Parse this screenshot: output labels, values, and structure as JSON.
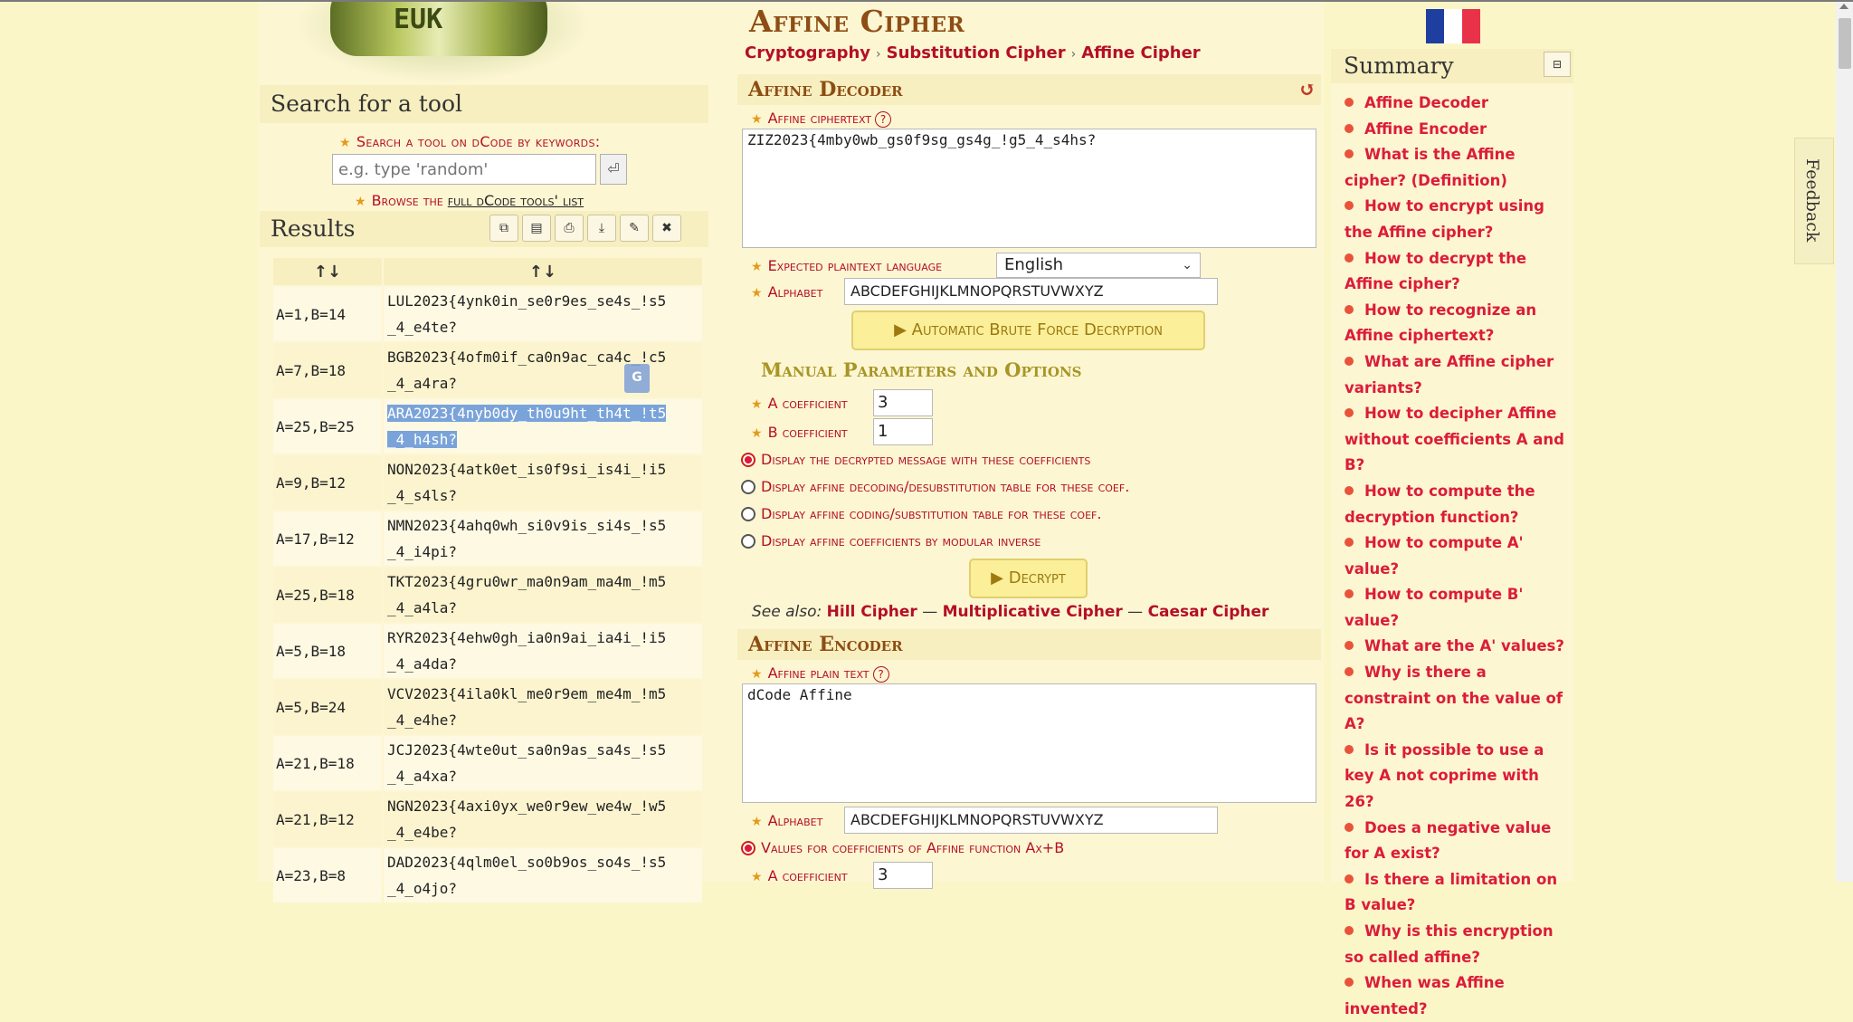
{
  "left": {
    "logo_letters": "EUK",
    "search": {
      "title": "Search for a tool",
      "keywords_label": "Search a tool on dCode by keywords:",
      "placeholder": "e.g. type 'random'",
      "go_icon": "enter-icon",
      "browse_prefix": "Browse the",
      "browse_link": "full dCode tools' list"
    },
    "results": {
      "title": "Results",
      "buttons": [
        "copy-icon",
        "copy-all-icon",
        "print-icon",
        "download-icon",
        "pin-icon",
        "close-icon"
      ],
      "headers": [
        "↑↓",
        "↑↓"
      ],
      "rows": [
        {
          "key": "A=1,B=14",
          "line1": "LUL2023{4ynk0in_se0r9es_se4s_!s5",
          "line2": "_4_e4te?"
        },
        {
          "key": "A=7,B=18",
          "line1": "BGB2023{4ofm0if_ca0n9ac_ca4c_!c5",
          "line2": "_4_a4ra?"
        },
        {
          "key": "A=25,B=25",
          "line1": "ARA2023{4nyb0dy_th0u9ht_th4t_!t5",
          "line2": "_4_h4sh?"
        },
        {
          "key": "A=9,B=12",
          "line1": "NON2023{4atk0et_is0f9si_is4i_!i5",
          "line2": "_4_s4ls?"
        },
        {
          "key": "A=17,B=12",
          "line1": "NMN2023{4ahq0wh_si0v9is_si4s_!s5",
          "line2": "_4_i4pi?"
        },
        {
          "key": "A=25,B=18",
          "line1": "TKT2023{4gru0wr_ma0n9am_ma4m_!m5",
          "line2": "_4_a4la?"
        },
        {
          "key": "A=5,B=18",
          "line1": "RYR2023{4ehw0gh_ia0n9ai_ia4i_!i5",
          "line2": "_4_a4da?"
        },
        {
          "key": "A=5,B=24",
          "line1": "VCV2023{4ila0kl_me0r9em_me4m_!m5",
          "line2": "_4_e4he?"
        },
        {
          "key": "A=21,B=18",
          "line1": "JCJ2023{4wte0ut_sa0n9as_sa4s_!s5",
          "line2": "_4_a4xa?"
        },
        {
          "key": "A=21,B=12",
          "line1": "NGN2023{4axi0yx_we0r9ew_we4w_!w5",
          "line2": "_4_e4be?"
        },
        {
          "key": "A=23,B=8",
          "line1": "DAD2023{4qlm0el_so0b9os_so4s_!s5",
          "line2": "_4_o4jo?"
        }
      ]
    }
  },
  "main": {
    "title": "Affine Cipher",
    "breadcrumb": [
      "Cryptography",
      "Substitution Cipher",
      "Affine Cipher"
    ],
    "flag_colors": [
      "#1f3fa0",
      "#ffffff",
      "#e8324a"
    ],
    "decoder": {
      "title": "Affine Decoder",
      "ciphertext_label": "Affine ciphertext",
      "ciphertext": "ZIZ2023{4mby0wb_gs0f9sg_gs4g_!g5_4_s4hs?",
      "lang_label": "Expected plaintext language",
      "lang_value": "English",
      "alphabet_label": "Alphabet",
      "alphabet": "ABCDEFGHIJKLMNOPQRSTUVWXYZ",
      "brute_button": "▶ Automatic Brute Force Decryption",
      "manual_title": "Manual Parameters and Options",
      "a_label": "A coefficient",
      "a_value": "3",
      "b_label": "B coefficient",
      "b_value": "1",
      "radio_options": [
        "Display the decrypted message with these coefficients",
        "Display affine decoding/desubstitution table for these coef.",
        "Display affine coding/substitution table for these coef.",
        "Display affine coefficients by modular inverse"
      ],
      "decrypt_button": "▶ Decrypt",
      "see_also_label": "See also:",
      "see_also": [
        "Hill Cipher",
        "Multiplicative Cipher",
        "Caesar Cipher"
      ]
    },
    "encoder": {
      "title": "Affine Encoder",
      "plain_label": "Affine plain text",
      "plain_text": "dCode Affine",
      "alphabet_label": "Alphabet",
      "alphabet": "ABCDEFGHIJKLMNOPQRSTUVWXYZ",
      "values_option": "Values for coefficients of Affine function Ax+B",
      "a_label": "A coefficient",
      "a_value": "3"
    }
  },
  "summary": {
    "title": "Summary",
    "items": [
      "Affine Decoder",
      "Affine Encoder",
      "What is the Affine cipher? (Definition)",
      "How to encrypt using the Affine cipher?",
      "How to decrypt the Affine cipher?",
      "How to recognize an Affine ciphertext?",
      "What are Affine cipher variants?",
      "How to decipher Affine without coefficients A and B?",
      "How to compute the decryption function?",
      "How to compute A' value?",
      "How to compute B' value?",
      "What are the A' values?",
      "Why is there a constraint on the value of A?",
      "Is it possible to use a key A not coprime with 26?",
      "Does a negative value for A exist?",
      "Is there a limitation on B value?",
      "Why is this encryption so called affine?",
      "When was Affine invented?"
    ]
  },
  "feedback_label": "Feedback"
}
